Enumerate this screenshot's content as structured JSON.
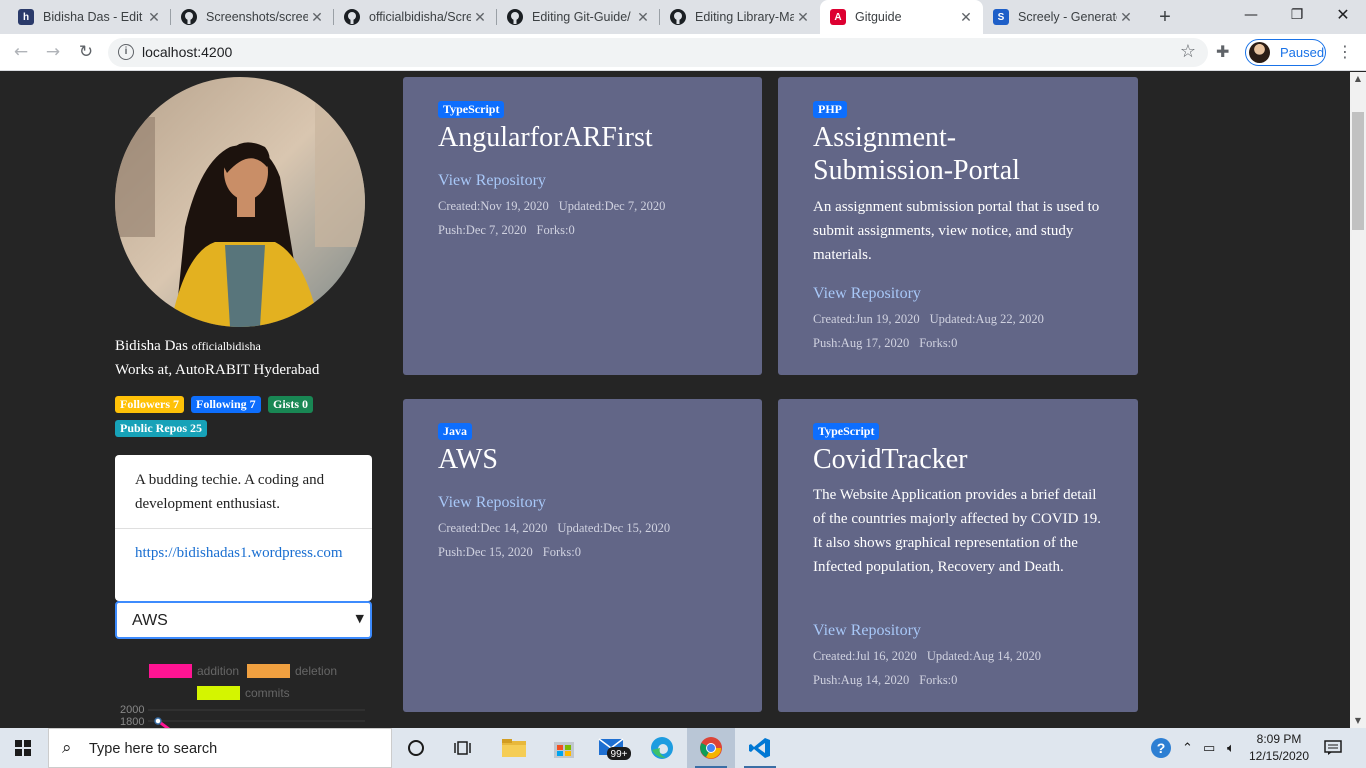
{
  "browser": {
    "tabs": [
      {
        "title": "Bidisha Das - Edit I",
        "favicon": "hashnode-icon",
        "fav_color": "#2a3a6a",
        "fav_text": "h"
      },
      {
        "title": "Screenshots/scree",
        "favicon": "github-icon",
        "fav_color": "#1b1f23",
        "fav_text": ""
      },
      {
        "title": "officialbidisha/Scre",
        "favicon": "github-icon",
        "fav_color": "#1b1f23",
        "fav_text": ""
      },
      {
        "title": "Editing Git-Guide/",
        "favicon": "github-icon",
        "fav_color": "#1b1f23",
        "fav_text": ""
      },
      {
        "title": "Editing Library-Ma",
        "favicon": "github-icon",
        "fav_color": "#1b1f23",
        "fav_text": ""
      },
      {
        "title": "Gitguide",
        "favicon": "angular-icon",
        "fav_color": "#dd0031",
        "fav_text": "A"
      },
      {
        "title": "Screely - Generate",
        "favicon": "screely-icon",
        "fav_color": "#1e5fc8",
        "fav_text": "S"
      }
    ],
    "active_tab": 5,
    "url": "localhost:4200",
    "profile_status": "Paused"
  },
  "profile": {
    "name": "Bidisha Das",
    "login": "officialbidisha",
    "company": "Works at, AutoRABIT Hyderabad",
    "followers": "Followers 7",
    "following": "Following 7",
    "gists": "Gists 0",
    "public_repos": "Public Repos 25",
    "bio": "A budding techie. A coding and development enthusiast.",
    "blog": "https://bidishadas1.wordpress.com",
    "selected_repo": "AWS"
  },
  "legend": [
    {
      "label": "addition",
      "color": "#ff1493"
    },
    {
      "label": "deletion",
      "color": "#f0a040"
    },
    {
      "label": "commits",
      "color": "#d4f500"
    }
  ],
  "chart_data": {
    "type": "line",
    "y_ticks": [
      "2000",
      "1800"
    ],
    "series": [
      {
        "name": "addition",
        "values": [
          1800
        ]
      }
    ]
  },
  "repos": [
    {
      "language": "TypeScript",
      "name": "AngularforARFirst",
      "description": "",
      "link": "View Repository",
      "created": "Created:Nov 19, 2020",
      "updated": "Updated:Dec 7, 2020",
      "push": "Push:Dec 7, 2020",
      "forks": "Forks:0"
    },
    {
      "language": "PHP",
      "name": "Assignment-Submission-Portal",
      "description": "An assignment submission portal that is used to submit assignments, view notice, and study materials.",
      "link": "View Repository",
      "created": "Created:Jun 19, 2020",
      "updated": "Updated:Aug 22, 2020",
      "push": "Push:Aug 17, 2020",
      "forks": "Forks:0"
    },
    {
      "language": "Java",
      "name": "AWS",
      "description": "",
      "link": "View Repository",
      "created": "Created:Dec 14, 2020",
      "updated": "Updated:Dec 15, 2020",
      "push": "Push:Dec 15, 2020",
      "forks": "Forks:0"
    },
    {
      "language": "TypeScript",
      "name": "CovidTracker",
      "description": "The Website Application provides a brief detail of the countries majorly affected by COVID 19. It also shows graphical representation of the Infected population, Recovery and Death.",
      "link": "View Repository",
      "created": "Created:Jul 16, 2020",
      "updated": "Updated:Aug 14, 2020",
      "push": "Push:Aug 14, 2020",
      "forks": "Forks:0"
    }
  ],
  "taskbar": {
    "search_placeholder": "Type here to search",
    "mail_badge": "99+",
    "time": "8:09 PM",
    "date": "12/15/2020"
  }
}
